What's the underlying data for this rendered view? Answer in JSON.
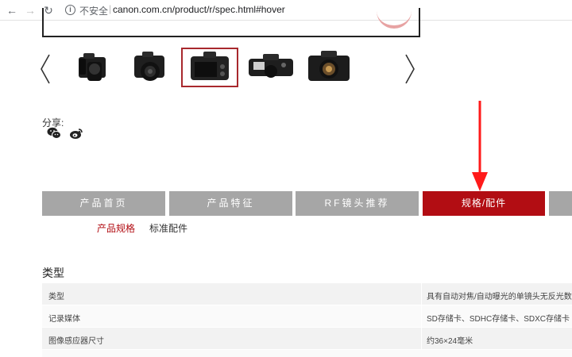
{
  "browser": {
    "security_label": "不安全",
    "separator": "|",
    "url": "canon.com.cn/product/r/spec.html#hover"
  },
  "carousel": {
    "thumbnails": [
      {
        "name": "camera-front-lens"
      },
      {
        "name": "camera-angle-lens"
      },
      {
        "name": "camera-back-screen",
        "selected": true
      },
      {
        "name": "camera-top"
      },
      {
        "name": "camera-front-body"
      }
    ]
  },
  "share": {
    "label": "分享:",
    "icons": [
      "wechat-icon",
      "weibo-icon"
    ]
  },
  "tabs": [
    {
      "label": "产品首页"
    },
    {
      "label": "产品特征"
    },
    {
      "label": "RF镜头推荐"
    },
    {
      "label": "规格/配件",
      "active": true
    }
  ],
  "subtabs": [
    {
      "label": "产品规格",
      "active": true
    },
    {
      "label": "标准配件"
    }
  ],
  "spec": {
    "section_title": "类型",
    "rows": [
      {
        "key": "类型",
        "value": "具有自动对焦/自动曝光的单镜头无反光数码"
      },
      {
        "key": "记录媒体",
        "value": "SD存储卡、SDHC存储卡、SDXC存储卡 ※"
      },
      {
        "key": "图像感应器尺寸",
        "value": "约36×24毫米"
      }
    ]
  },
  "colors": {
    "accent_red": "#b20d13",
    "tab_gray": "#a6a6a6"
  }
}
